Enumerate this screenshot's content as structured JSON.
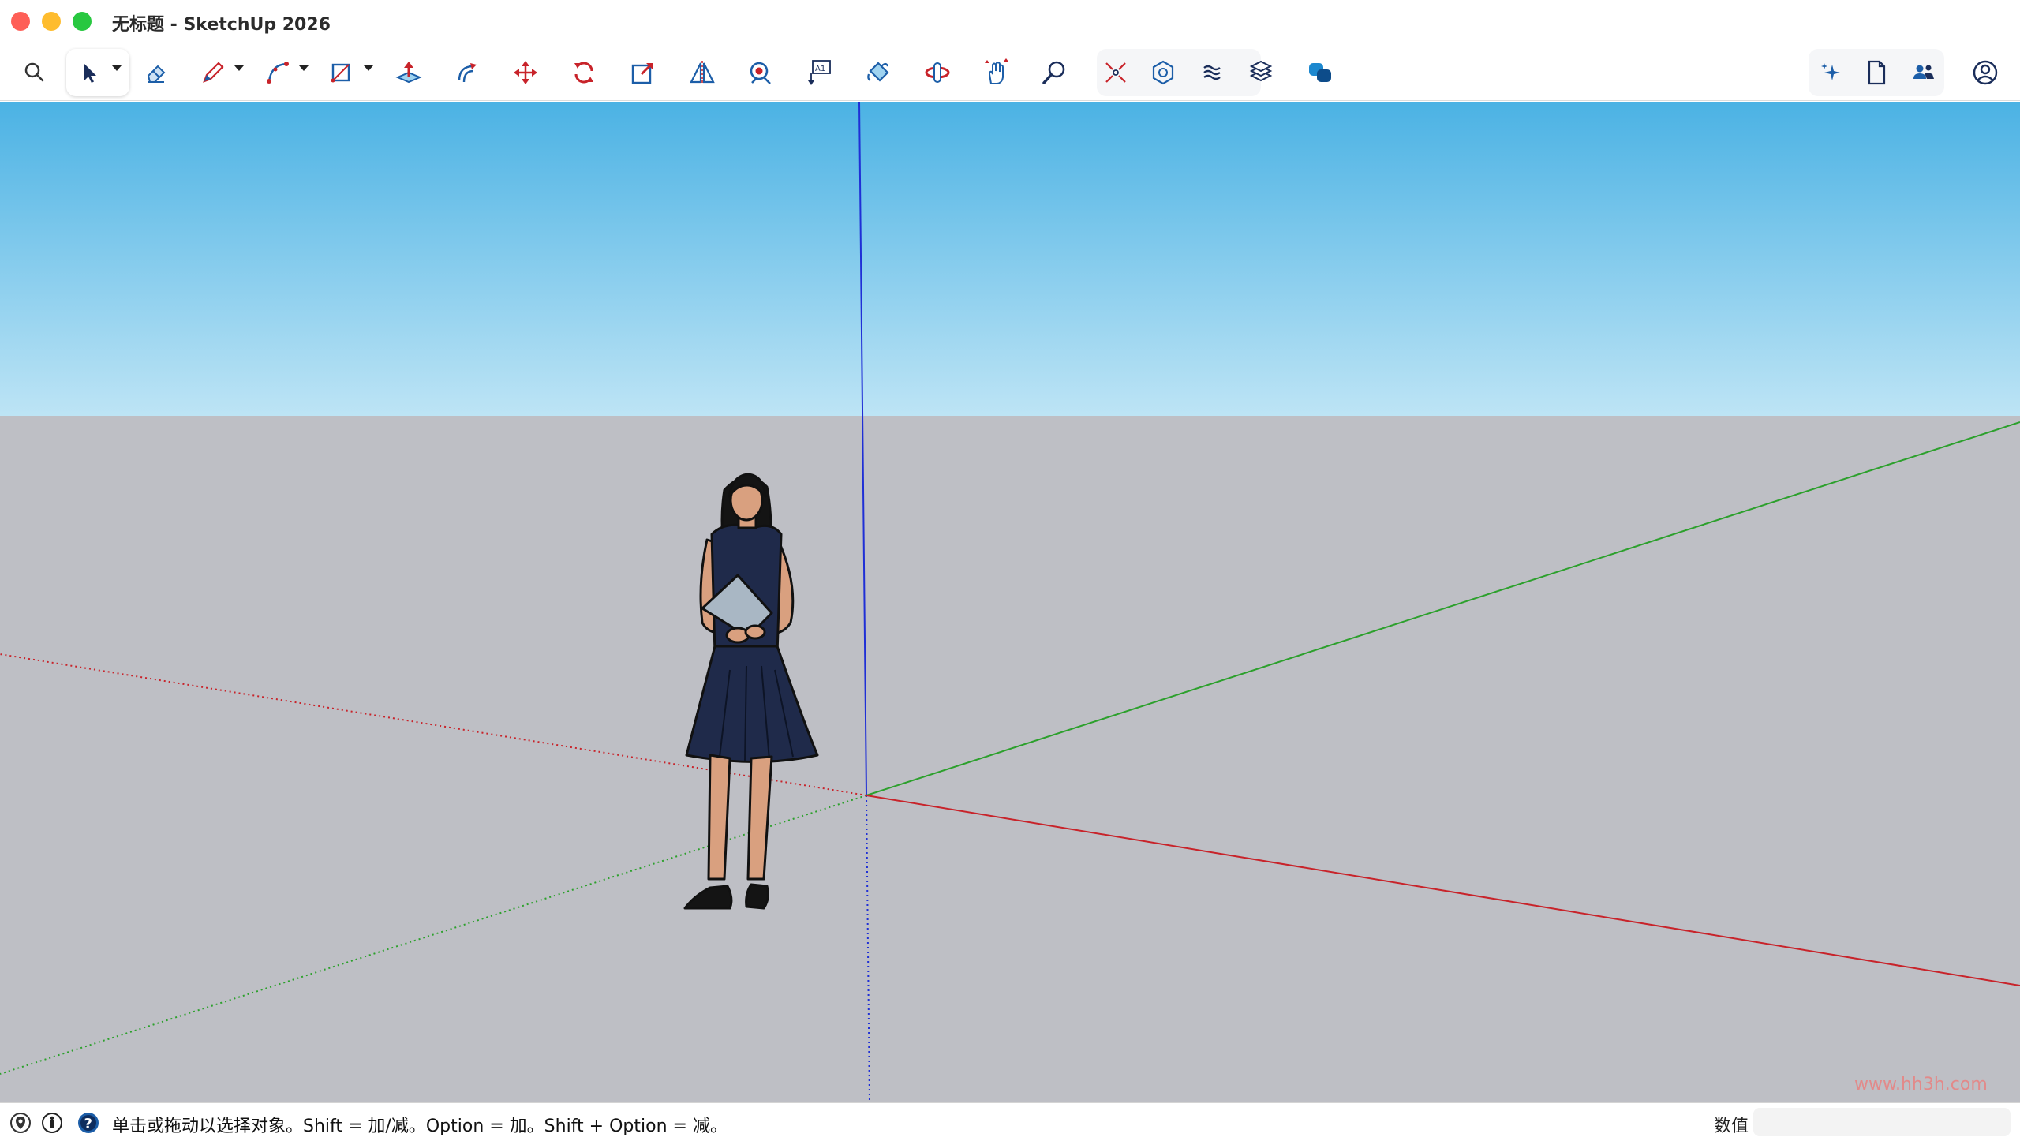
{
  "window": {
    "title": "无标题 - SketchUp 2026"
  },
  "toolbar": {
    "tools": [
      {
        "name": "search-icon",
        "label": "Search"
      },
      {
        "name": "select-icon",
        "label": "Select"
      },
      {
        "name": "eraser-icon",
        "label": "Eraser"
      },
      {
        "name": "pencil-icon",
        "label": "Line"
      },
      {
        "name": "arc-icon",
        "label": "Arc"
      },
      {
        "name": "rectangle-icon",
        "label": "Rectangle"
      },
      {
        "name": "push-pull-icon",
        "label": "Push/Pull"
      },
      {
        "name": "offset-icon",
        "label": "Offset"
      },
      {
        "name": "move-icon",
        "label": "Move"
      },
      {
        "name": "rotate-icon",
        "label": "Rotate"
      },
      {
        "name": "scale-icon",
        "label": "Scale"
      },
      {
        "name": "flip-icon",
        "label": "Flip"
      },
      {
        "name": "tape-measure-icon",
        "label": "Tape Measure"
      },
      {
        "name": "text-icon",
        "label": "Text"
      },
      {
        "name": "paint-bucket-icon",
        "label": "Paint Bucket"
      },
      {
        "name": "orbit-icon",
        "label": "Orbit"
      },
      {
        "name": "pan-icon",
        "label": "Pan"
      },
      {
        "name": "zoom-icon",
        "label": "Zoom"
      },
      {
        "name": "zoom-extents-icon",
        "label": "Zoom Extents"
      },
      {
        "name": "components-icon",
        "label": "Components"
      },
      {
        "name": "styles-icon",
        "label": "Styles"
      },
      {
        "name": "layers-icon",
        "label": "Tags"
      },
      {
        "name": "extensions-icon",
        "label": "Extensions"
      },
      {
        "name": "ai-sparkle-icon",
        "label": "AI"
      },
      {
        "name": "document-icon",
        "label": "Document"
      },
      {
        "name": "collaborators-icon",
        "label": "Collaborators"
      },
      {
        "name": "account-icon",
        "label": "Account"
      }
    ]
  },
  "colors": {
    "sky_top": "#4bb2e4",
    "sky_bottom": "#bde4f5",
    "ground": "#bebfc5",
    "axis_red": "#c8232a",
    "axis_green": "#2ca02c",
    "axis_blue": "#1f2fd6",
    "accent": "#1c5ea8"
  },
  "viewport": {
    "figure": "scale-figure-woman"
  },
  "watermark": "www.hh3h.com",
  "status": {
    "message": "单击或拖动以选择对象。Shift = 加/减。Option = 加。Shift + Option = 减。",
    "measure_label": "数值",
    "measure_value": ""
  }
}
